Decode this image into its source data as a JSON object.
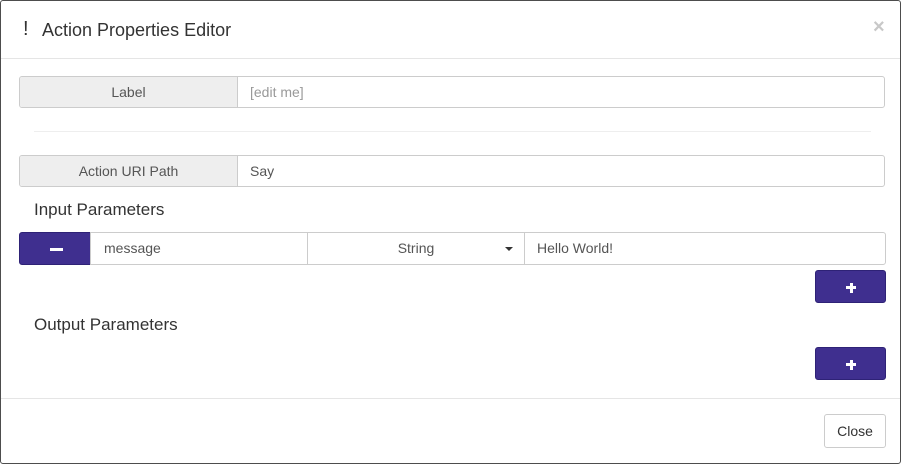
{
  "dialog": {
    "title": "Action Properties Editor",
    "header_icon_glyph": "!",
    "close_glyph": "×"
  },
  "fields": {
    "label": {
      "addon": "Label",
      "value": "",
      "placeholder": "[edit me]"
    },
    "action_uri": {
      "addon": "Action URI Path",
      "value": "Say"
    }
  },
  "input_parameters": {
    "heading": "Input Parameters",
    "rows": [
      {
        "name": "message",
        "type": "String",
        "value": "Hello World!"
      }
    ]
  },
  "output_parameters": {
    "heading": "Output Parameters",
    "rows": []
  },
  "footer": {
    "close_label": "Close"
  },
  "colors": {
    "accent": "#3f2f8f",
    "addon_bg": "#eeeeee",
    "border": "#cccccc"
  },
  "icons": [
    "alert-icon",
    "close-icon",
    "minus-icon",
    "plus-icon",
    "caret-down-icon"
  ]
}
